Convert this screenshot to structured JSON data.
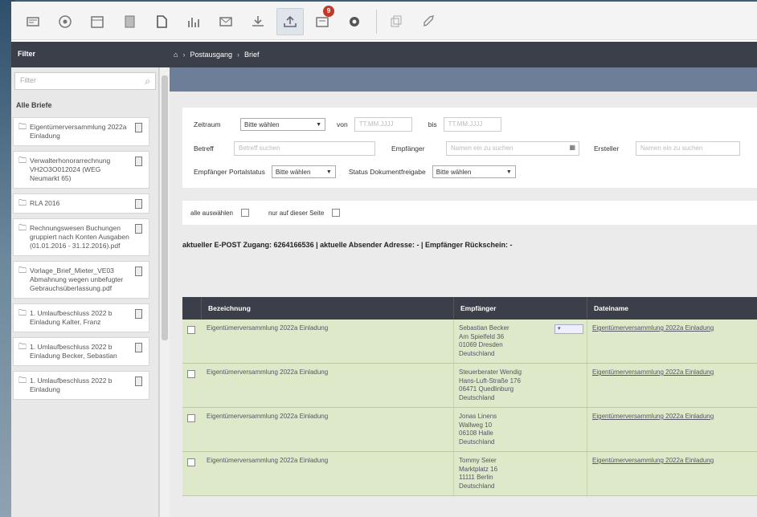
{
  "toolbar": {
    "tools": [
      {
        "icon": "mail-icon"
      },
      {
        "icon": "target-icon"
      },
      {
        "icon": "calendar-icon"
      },
      {
        "icon": "document-icon"
      },
      {
        "icon": "page-icon"
      },
      {
        "icon": "chart-icon"
      },
      {
        "icon": "envelope-icon"
      },
      {
        "icon": "download-icon"
      },
      {
        "icon": "upload-icon",
        "active": true
      },
      {
        "icon": "inbox-icon",
        "badge": "9"
      },
      {
        "icon": "gear-icon"
      },
      {
        "icon": "copy-icon"
      },
      {
        "icon": "rocket-icon"
      }
    ]
  },
  "sidebar": {
    "header": "Filter",
    "filter_placeholder": "Filter",
    "all_letters": "Alle Briefe",
    "items": [
      {
        "label": "Eigentümerversammlung 2022a Einladung"
      },
      {
        "label": "Verwalterhonorarrechnung VH2O3O012024 (WEG Neumarkt 65)"
      },
      {
        "label": "RLA 2016"
      },
      {
        "label": "Rechnungswesen Buchungen gruppiert nach Konten Ausgaben (01.01.2016 - 31.12.2016).pdf"
      },
      {
        "label": "Vorlage_Brief_Mieter_VE03 Abmahnung wegen unbefugter Gebrauchsüberlassung.pdf"
      },
      {
        "label": "1. Umlaufbeschluss 2022 b Einladung Kalter, Franz"
      },
      {
        "label": "1. Umlaufbeschluss 2022 b Einladung Becker, Sebastian"
      },
      {
        "label": "1. Umlaufbeschluss 2022 b Einladung"
      }
    ]
  },
  "breadcrumb": {
    "home": "⌂",
    "items": [
      "Postausgang",
      "Brief"
    ]
  },
  "filters": {
    "zeitraum_label": "Zeitraum",
    "zeitraum_value": "Bitte wählen",
    "von_label": "von",
    "von_placeholder": "TT.MM.JJJJ",
    "bis_label": "bis",
    "bis_placeholder": "TT.MM.JJJJ",
    "betreff_label": "Betreff",
    "betreff_placeholder": "Betreff suchen",
    "empfaenger_label": "Empfänger",
    "empfaenger_placeholder": "Namen ein zu suchen",
    "ersteller_label": "Ersteller",
    "ersteller_placeholder": "Namen ein zu suchen",
    "portal_label": "Empfänger Portalstatus",
    "portal_value": "Bitte wählen",
    "status_label": "Status Dokumentfreigabe",
    "status_value": "Bitte wählen"
  },
  "selection": {
    "select_all": "alle auswählen",
    "this_page": "nur auf dieser Seite"
  },
  "info_line": "aktueller E-POST Zugang: 6264166536 | aktuelle Absender Adresse: - | Empfänger Rückschein: -",
  "table": {
    "headers": [
      "Bezeichnung",
      "Empfänger",
      "Dateiname"
    ],
    "rows": [
      {
        "title": "Eigentümerversammlung 2022a Einladung",
        "recipient": [
          "Sebastian Becker",
          "Am Spielfeld 36",
          "01069 Dresden",
          "Deutschland"
        ],
        "file": "Eigentümerversammlung 2022a Einladung"
      },
      {
        "title": "Eigentümerversammlung 2022a Einladung",
        "recipient": [
          "Steuerberater Wendig",
          "Hans-Luft-Straße 176",
          "06471 Quedlinburg",
          "Deutschland"
        ],
        "file": "Eigentümerversammlung 2022a Einladung"
      },
      {
        "title": "Eigentümerversammlung 2022a Einladung",
        "recipient": [
          "Jonas Linens",
          "Wallweg 10",
          "06108 Halle",
          "Deutschland"
        ],
        "file": "Eigentümerversammlung 2022a Einladung"
      },
      {
        "title": "Eigentümerversammlung 2022a Einladung",
        "recipient": [
          "Tommy Seier",
          "Marktplatz 16",
          "11111 Berlin",
          "Deutschland"
        ],
        "file": "Eigentümerversammlung 2022a Einladung"
      }
    ]
  }
}
